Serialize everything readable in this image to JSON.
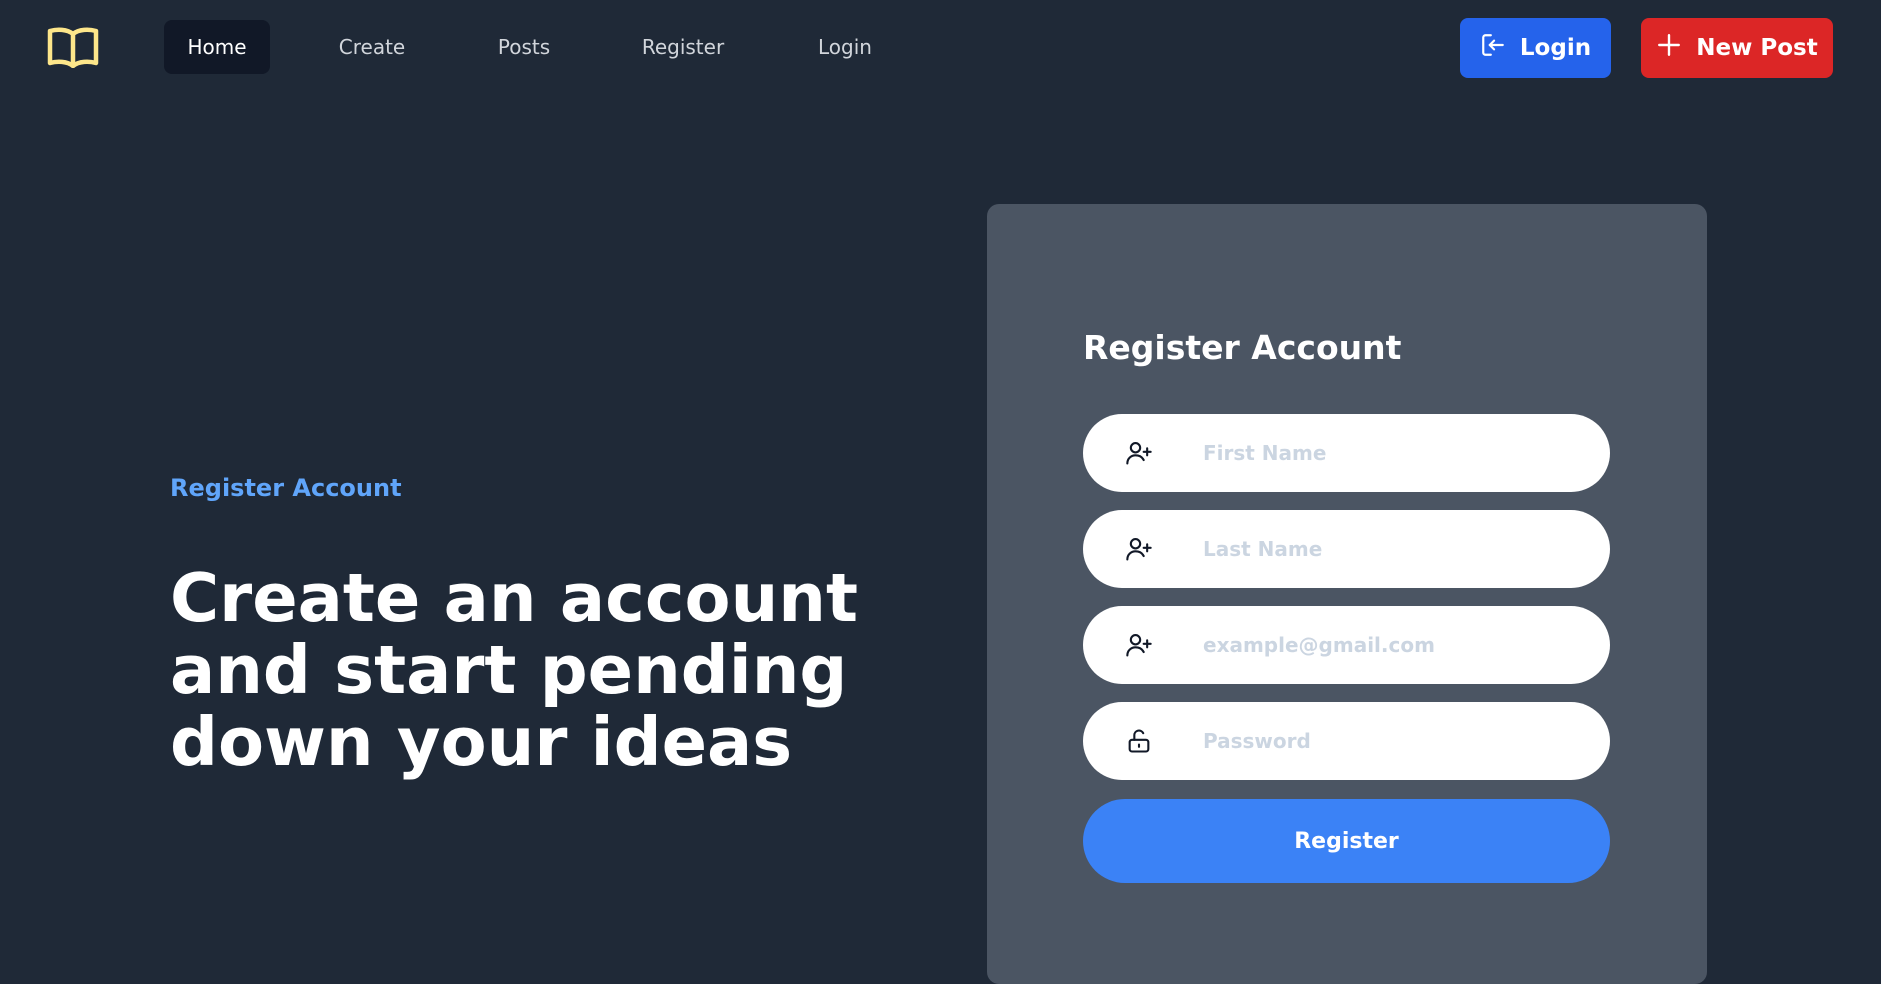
{
  "nav": {
    "logo_icon": "open-book-icon",
    "logo_color": "#fde68a",
    "links": [
      {
        "label": "Home",
        "active": true
      },
      {
        "label": "Create"
      },
      {
        "label": "Posts"
      },
      {
        "label": "Register"
      },
      {
        "label": "Login"
      }
    ],
    "login_button": {
      "label": "Login",
      "icon": "login-icon",
      "color": "#2563eb"
    },
    "new_post_button": {
      "label": "New Post",
      "icon": "plus-icon",
      "color": "#dc2626"
    }
  },
  "hero": {
    "eyebrow": "Register Account",
    "lines": [
      "Create an account",
      "and start pending",
      "down your ideas"
    ]
  },
  "form": {
    "title": "Register Account",
    "fields": [
      {
        "placeholder": "First Name",
        "icon": "user-plus-icon"
      },
      {
        "placeholder": "Last Name",
        "icon": "user-plus-icon"
      },
      {
        "placeholder": "example@gmail.com",
        "icon": "user-plus-icon"
      },
      {
        "placeholder": "Password",
        "icon": "lock-open-icon"
      }
    ],
    "submit_label": "Register"
  },
  "colors": {
    "background": "#1f2937",
    "card": "#4b5563",
    "accent": "#3b82f6",
    "eyebrow": "#60a5fa"
  }
}
